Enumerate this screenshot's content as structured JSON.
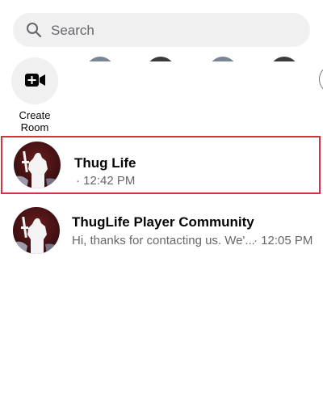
{
  "search": {
    "placeholder": "Search"
  },
  "create_room": {
    "label": "Create Room"
  },
  "conversations": [
    {
      "name": "Thug Life",
      "preview": "",
      "time": "12:42 PM"
    },
    {
      "name": "ThugLife Player Community",
      "preview": "Hi, thanks for contacting us. We'...",
      "time": "12:05 PM"
    }
  ],
  "separator": "·",
  "colors": {
    "highlight": "#d1343e",
    "search_bg": "#f0f0f0",
    "secondary_text": "#65676b"
  }
}
